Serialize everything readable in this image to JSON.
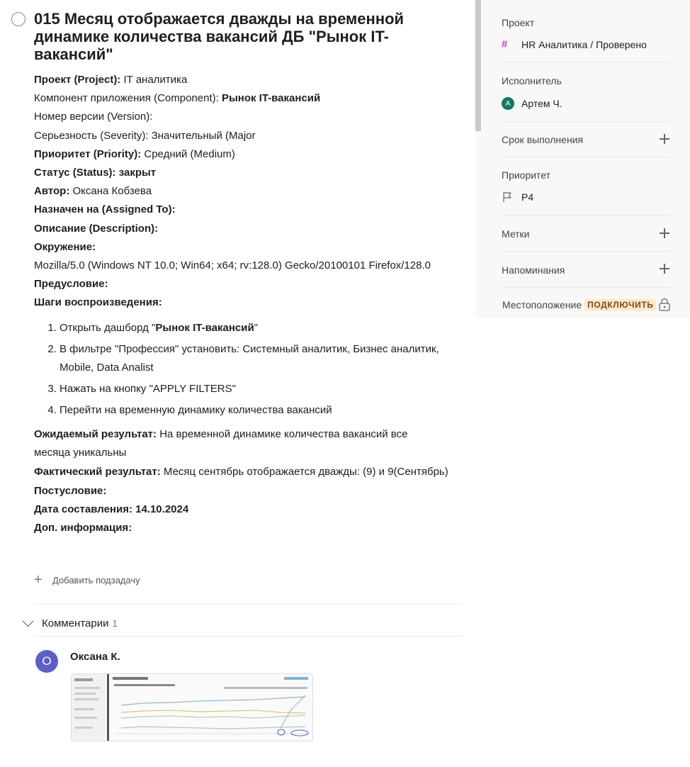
{
  "task": {
    "title": "015 Месяц отображается дважды на временной динамике количества вакансий ДБ \"Рынок IT-вакансий\"",
    "fields": [
      {
        "label": "Проект (Project):",
        "value": " IT аналитика",
        "label_bold": true,
        "value_bold": false
      },
      {
        "label": "Компонент приложения (Component): ",
        "value": "Рынок IT-вакансий",
        "label_bold": false,
        "value_bold": true
      },
      {
        "label": "Номер версии (Version):",
        "value": "",
        "label_bold": false,
        "value_bold": false
      },
      {
        "label": "Серьезность (Severity): Значительный (Major",
        "value": "",
        "label_bold": false,
        "value_bold": false
      },
      {
        "label": "Приоритет (Priority):",
        "value": " Средний (Medium)",
        "label_bold": true,
        "value_bold": false
      },
      {
        "label": "Статус (Status): закрыт",
        "value": "",
        "label_bold": true,
        "value_bold": false
      },
      {
        "label": "Автор:",
        "value": " Оксана Кобзева",
        "label_bold": true,
        "value_bold": false
      },
      {
        "label": "Назначен на (Assigned To):",
        "value": "",
        "label_bold": true,
        "value_bold": false
      },
      {
        "label": "Описание (Description):",
        "value": "",
        "label_bold": true,
        "value_bold": false
      },
      {
        "label": "Окружение:",
        "value": "",
        "label_bold": true,
        "value_bold": false
      },
      {
        "label": "",
        "value": "Mozilla/5.0 (Windows NT 10.0; Win64; x64; rv:128.0) Gecko/20100101 Firefox/128.0",
        "label_bold": false,
        "value_bold": false
      },
      {
        "label": "Предусловие:",
        "value": "",
        "label_bold": true,
        "value_bold": false
      },
      {
        "label": "Шаги воспроизведения:",
        "value": "",
        "label_bold": true,
        "value_bold": false
      }
    ],
    "steps": [
      {
        "pre": "Открыть дашборд \"",
        "bold": "Рынок IT-вакансий",
        "post": "\""
      },
      {
        "pre": "В фильтре \"Профессия\" установить: Системный аналитик, Бизнес аналитик, Mobile, Data Analist",
        "bold": "",
        "post": ""
      },
      {
        "pre": "Нажать на кнопку \"APPLY FILTERS\"",
        "bold": "",
        "post": ""
      },
      {
        "pre": "Перейти на временную динамику количества вакансий",
        "bold": "",
        "post": ""
      }
    ],
    "after_fields": [
      {
        "label": "Ожидаемый результат:",
        "value": " На временной динамике количества вакансий все месяца уникальны",
        "label_bold": true,
        "value_bold": false
      },
      {
        "label": "Фактический результат:",
        "value": " Месяц сентябрь отображается дважды: (9) и 9(Сентябрь)",
        "label_bold": true,
        "value_bold": false
      },
      {
        "label": "Постусловие:",
        "value": "",
        "label_bold": true,
        "value_bold": false
      },
      {
        "label": "Дата составления: 14.10.2024",
        "value": "",
        "label_bold": true,
        "value_bold": false
      },
      {
        "label": "Доп. информация:",
        "value": "",
        "label_bold": true,
        "value_bold": false
      }
    ],
    "add_subtask_label": "Добавить подзадачу"
  },
  "comments": {
    "label": "Комментарии",
    "count": "1",
    "items": [
      {
        "author": "Оксана К.",
        "avatar_letter": "О"
      }
    ]
  },
  "sidebar": {
    "project_label": "Проект",
    "project_value": "HR Аналитика / Проверено",
    "assignee_label": "Исполнитель",
    "assignee_value": "Артем Ч.",
    "assignee_initial": "А",
    "due_label": "Срок выполнения",
    "priority_label": "Приоритет",
    "priority_value": "P4",
    "labels_label": "Метки",
    "reminders_label": "Напоминания",
    "location_label": "Местоположение",
    "location_badge": "ПОДКЛЮЧИТЬ"
  },
  "colors": {
    "project_hash": "#b340d6",
    "assignee_avatar": "#0f7a64",
    "comment_avatar": "#5b5fc7",
    "badge_bg": "#fde7cf"
  }
}
